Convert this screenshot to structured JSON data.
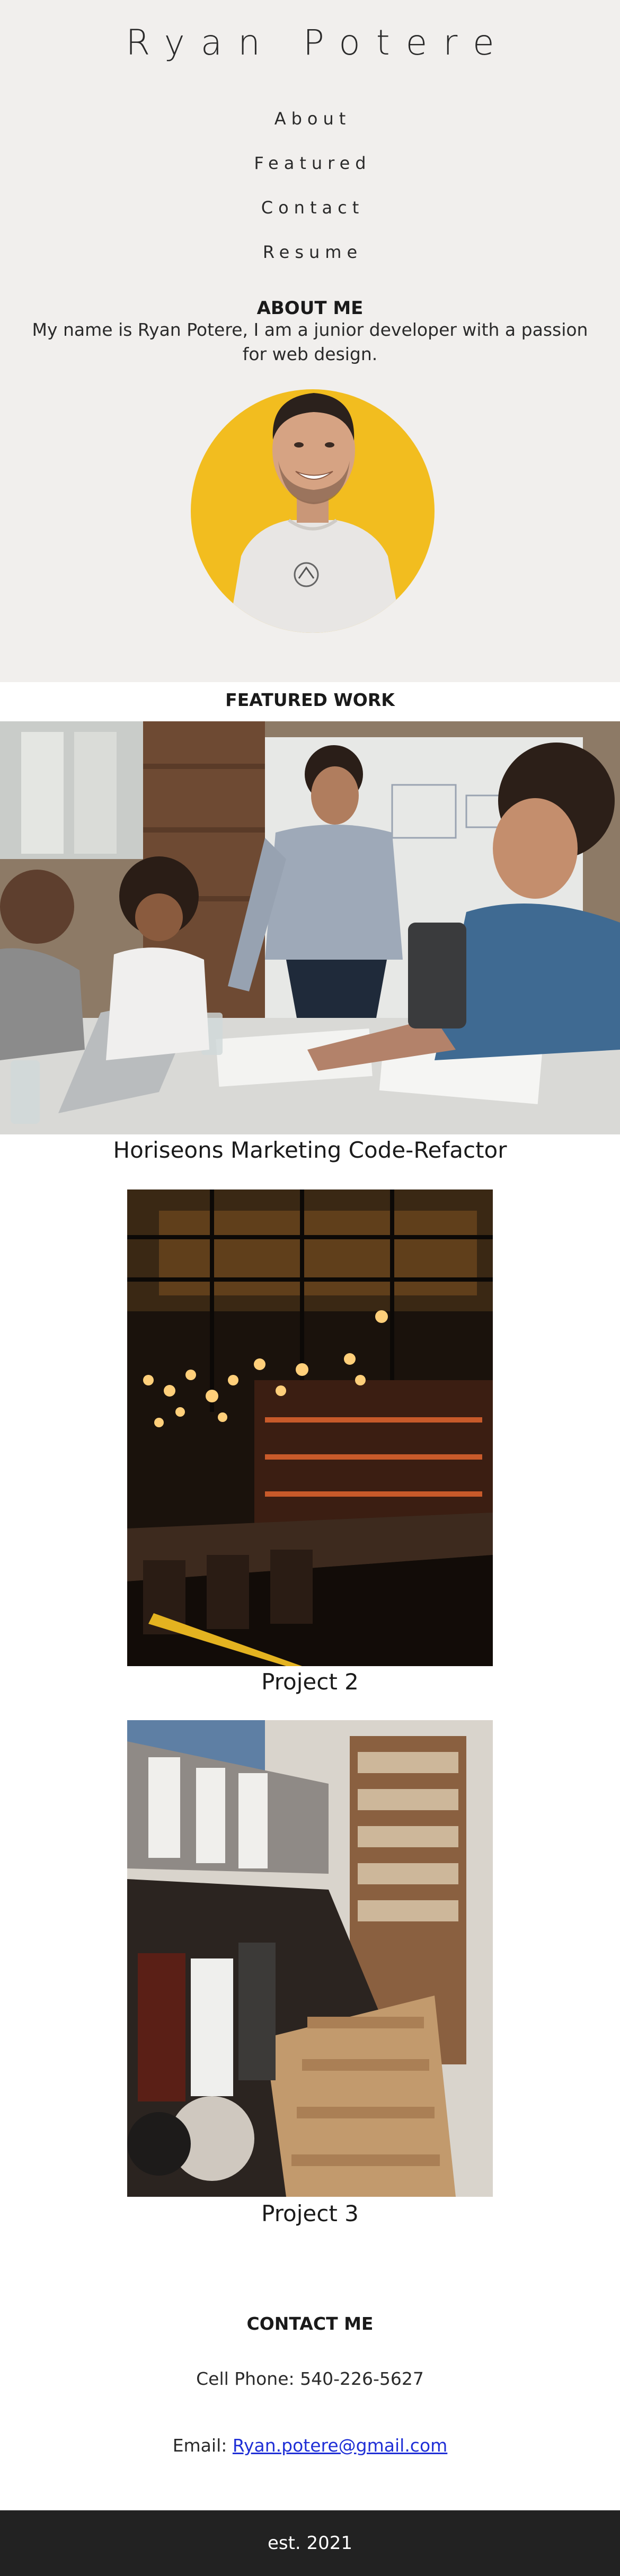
{
  "header": {
    "title": "Ryan Potere"
  },
  "nav": {
    "items": [
      {
        "label": "About"
      },
      {
        "label": "Featured"
      },
      {
        "label": "Contact"
      },
      {
        "label": "Resume"
      }
    ]
  },
  "about": {
    "heading": "ABOUT ME",
    "text": "My name is Ryan Potere, I am a junior developer with a passion for web design."
  },
  "featured": {
    "heading": "FEATURED WORK",
    "projects": [
      {
        "caption": "Horiseons Marketing Code-Refactor"
      },
      {
        "caption": "Project 2"
      },
      {
        "caption": "Project 3"
      }
    ]
  },
  "contact": {
    "heading": "CONTACT ME",
    "phone": "Cell Phone: 540-226-5627",
    "email_prefix": "Email: ",
    "email": "Ryan.potere@gmail.com"
  },
  "footer": {
    "text": "est. 2021"
  },
  "colors": {
    "page_background": "#f1efed",
    "portrait_circle": "#f2bd1f",
    "footer_background": "#222222",
    "link": "#1f2fd6"
  }
}
